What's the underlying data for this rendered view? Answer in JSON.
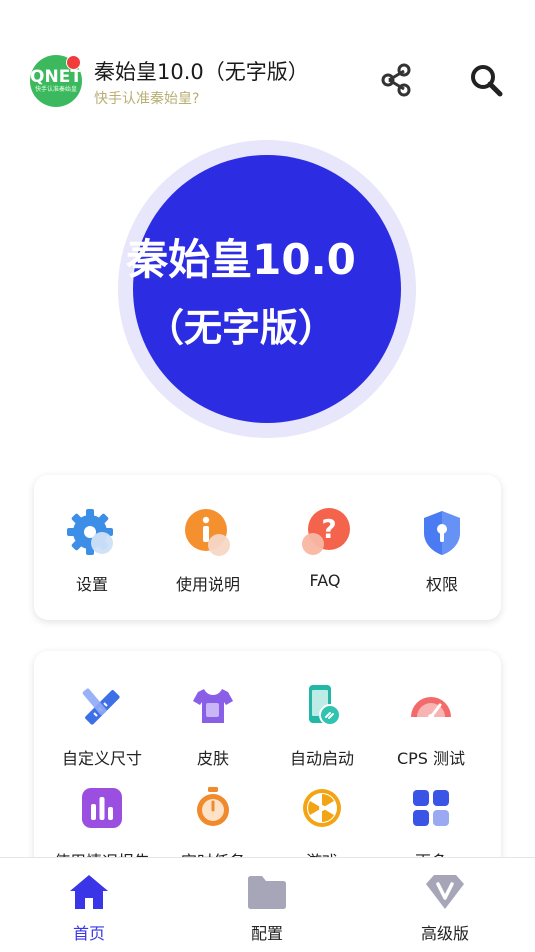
{
  "header": {
    "avatar_text": "QNET",
    "avatar_subtext": "快手认准秦始皇",
    "title": "秦始皇10.0（无字版）",
    "subtitle": "快手认准秦始皇?",
    "share_icon": "share-icon",
    "search_icon": "search-icon"
  },
  "hero": {
    "line1": "秦始皇10.0",
    "line2": "（无字版）",
    "color": "#2c2ce3"
  },
  "quick_actions": [
    {
      "label": "设置",
      "icon": "gear-icon"
    },
    {
      "label": "使用说明",
      "icon": "info-icon"
    },
    {
      "label": "FAQ",
      "icon": "question-icon"
    },
    {
      "label": "权限",
      "icon": "shield-icon"
    }
  ],
  "tools": [
    {
      "label": "自定义尺寸",
      "icon": "ruler-pencil-icon"
    },
    {
      "label": "皮肤",
      "icon": "tshirt-icon"
    },
    {
      "label": "自动启动",
      "icon": "phone-link-icon"
    },
    {
      "label": "CPS 测试",
      "icon": "speedometer-icon"
    },
    {
      "label": "使用情况报告",
      "icon": "bar-chart-icon"
    },
    {
      "label": "定时任务",
      "icon": "stopwatch-icon"
    },
    {
      "label": "游戏",
      "icon": "game-wheel-icon"
    },
    {
      "label": "更多",
      "icon": "grid-more-icon"
    }
  ],
  "nav": {
    "items": [
      {
        "label": "首页",
        "icon": "home-icon",
        "active": true
      },
      {
        "label": "配置",
        "icon": "folder-icon",
        "active": false
      },
      {
        "label": "高级版",
        "icon": "vip-v-icon",
        "active": false
      }
    ],
    "active_color": "#3a36e8",
    "inactive_color": "#222222"
  }
}
